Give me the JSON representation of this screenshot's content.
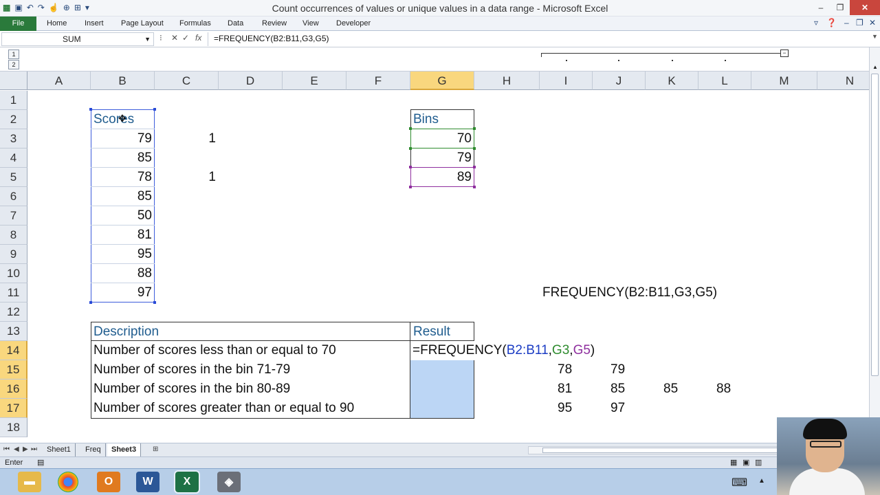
{
  "window": {
    "title": "Count occurrences of values or unique values in a data range - Microsoft Excel"
  },
  "ribbon": {
    "tabs": [
      "File",
      "Home",
      "Insert",
      "Page Layout",
      "Formulas",
      "Data",
      "Review",
      "View",
      "Developer"
    ]
  },
  "formula_bar": {
    "name_box": "SUM",
    "formula": "=FREQUENCY(B2:B11,G3,G5)"
  },
  "outline": {
    "levels": [
      "1",
      "2"
    ]
  },
  "columns": [
    "A",
    "B",
    "C",
    "D",
    "E",
    "F",
    "G",
    "H",
    "I",
    "J",
    "K",
    "L",
    "M",
    "N"
  ],
  "rows": [
    "1",
    "2",
    "3",
    "4",
    "5",
    "6",
    "7",
    "8",
    "9",
    "10",
    "11",
    "12",
    "13",
    "14",
    "15",
    "16",
    "17",
    "18"
  ],
  "cells": {
    "scores_header": "Scores",
    "scores": [
      "79",
      "85",
      "78",
      "85",
      "50",
      "81",
      "95",
      "88",
      "97"
    ],
    "c3": "1",
    "c5": "1",
    "bins_header": "Bins",
    "bins": [
      "70",
      "79",
      "89"
    ],
    "i11_text": "FREQUENCY(B2:B11,G3,G5)",
    "description_header": "Description",
    "result_header": "Result",
    "descriptions": [
      "Number of scores less than or equal to 70",
      "Number of scores in the bin 71-79",
      "Number of scores in the bin 80-89",
      "Number of scores greater than or equal to 90"
    ],
    "edit_formula": {
      "prefix": "=FREQUENCY(",
      "range": "B2:B11",
      "sep1": ",",
      "ref1": "G3",
      "sep2": ",",
      "ref2": "G5",
      "suffix": ")"
    },
    "row15": [
      "78",
      "79"
    ],
    "row16": [
      "81",
      "85",
      "85",
      "88"
    ],
    "row17": [
      "95",
      "97"
    ]
  },
  "sheets": [
    "Sheet1",
    "Freq",
    "Sheet3"
  ],
  "active_sheet": "Sheet3",
  "status": {
    "mode": "Enter"
  },
  "colors": {
    "accent_green": "#2a7a3b",
    "header_blue": "#1f5c8e",
    "ref_blue": "#1b3cc4",
    "ref_green": "#2e8b2e",
    "ref_purple": "#8e2e9e",
    "selection_fill": "#bcd6f5"
  }
}
